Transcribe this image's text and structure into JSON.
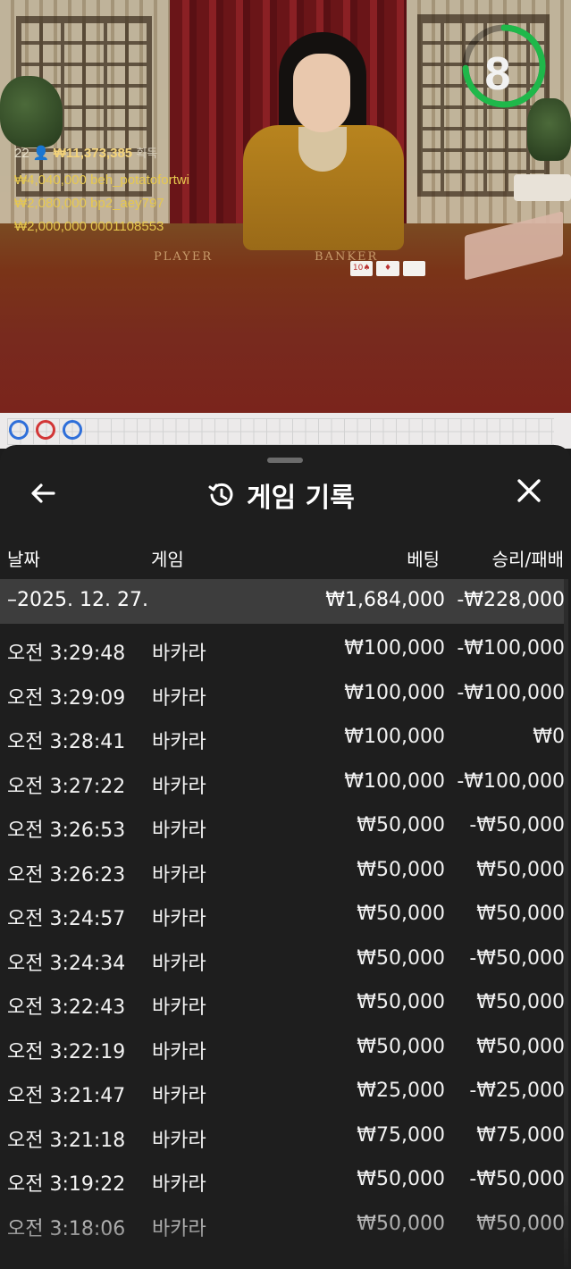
{
  "live_video": {
    "timer": "8",
    "timer_color": "#1fb84a",
    "total_players": "22",
    "total_winnings": "₩11,373,385",
    "total_label": "획득",
    "winners": [
      {
        "amount": "₩4,040,000",
        "user": "beh_potatofortwi"
      },
      {
        "amount": "₩2,080,000",
        "user": "bp2_aey797"
      },
      {
        "amount": "₩2,000,000",
        "user": "0001108553"
      }
    ],
    "table_player": "PLAYER",
    "table_banker": "BANKER"
  },
  "history": {
    "title": "게임 기록",
    "back_icon": "arrow-left-icon",
    "close_icon": "close-icon",
    "columns": {
      "date": "날짜",
      "game": "게임",
      "bet": "베팅",
      "result": "승리/패배"
    },
    "date_group": {
      "date": "–2025. 12. 27.",
      "bet": "₩1,684,000",
      "result": "-₩228,000"
    },
    "rows": [
      {
        "time": "오전 3:29:48",
        "game": "바카라",
        "bet": "₩100,000",
        "result": "-₩100,000"
      },
      {
        "time": "오전 3:29:09",
        "game": "바카라",
        "bet": "₩100,000",
        "result": "-₩100,000"
      },
      {
        "time": "오전 3:28:41",
        "game": "바카라",
        "bet": "₩100,000",
        "result": "₩0"
      },
      {
        "time": "오전 3:27:22",
        "game": "바카라",
        "bet": "₩100,000",
        "result": "-₩100,000"
      },
      {
        "time": "오전 3:26:53",
        "game": "바카라",
        "bet": "₩50,000",
        "result": "-₩50,000"
      },
      {
        "time": "오전 3:26:23",
        "game": "바카라",
        "bet": "₩50,000",
        "result": "₩50,000"
      },
      {
        "time": "오전 3:24:57",
        "game": "바카라",
        "bet": "₩50,000",
        "result": "₩50,000"
      },
      {
        "time": "오전 3:24:34",
        "game": "바카라",
        "bet": "₩50,000",
        "result": "-₩50,000"
      },
      {
        "time": "오전 3:22:43",
        "game": "바카라",
        "bet": "₩50,000",
        "result": "₩50,000"
      },
      {
        "time": "오전 3:22:19",
        "game": "바카라",
        "bet": "₩50,000",
        "result": "₩50,000"
      },
      {
        "time": "오전 3:21:47",
        "game": "바카라",
        "bet": "₩25,000",
        "result": "-₩25,000"
      },
      {
        "time": "오전 3:21:18",
        "game": "바카라",
        "bet": "₩75,000",
        "result": "₩75,000"
      },
      {
        "time": "오전 3:19:22",
        "game": "바카라",
        "bet": "₩50,000",
        "result": "-₩50,000"
      },
      {
        "time": "오전 3:18:06",
        "game": "바카라",
        "bet": "₩50,000",
        "result": "₩50,000"
      }
    ]
  }
}
